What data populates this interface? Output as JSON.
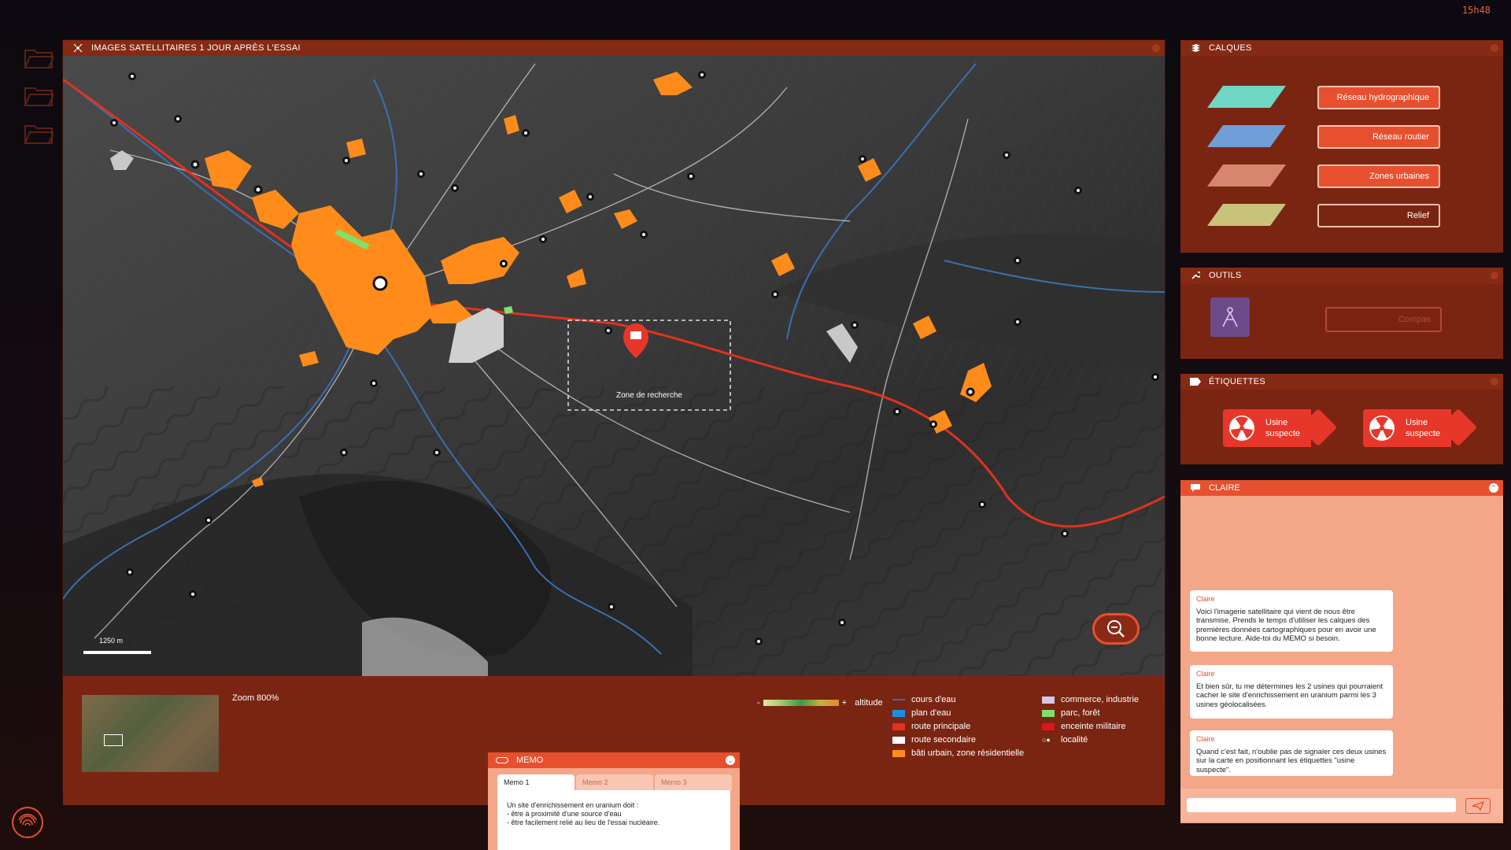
{
  "clock": "15h48",
  "map_window": {
    "title": "IMAGES SATELLITAIRES 1 JOUR APRÈS L'ESSAI",
    "search_zone_label": "Zone de recherche",
    "scale_label": "1250 m",
    "zoom_label": "Zoom 800%"
  },
  "legend": {
    "altitude_minus": "-",
    "altitude_plus": "+",
    "altitude_label": "altitude",
    "items": [
      {
        "label": "cours d'eau",
        "color": "#3a6fb0"
      },
      {
        "label": "plan d'eau",
        "color": "#1a8fe0"
      },
      {
        "label": "route principale",
        "color": "#e0321e"
      },
      {
        "label": "route secondaire",
        "color": "#ffffff"
      },
      {
        "label": "bâti urbain, zone résidentielle",
        "color": "#ff8c1a"
      },
      {
        "label": "commerce, industrie",
        "color": "#d6c7e6"
      },
      {
        "label": "parc, forêt",
        "color": "#7fe06a"
      },
      {
        "label": "enceinte militaire",
        "color": "#e0151a"
      },
      {
        "label": "localité",
        "color": "#ffffff"
      }
    ]
  },
  "calques": {
    "title": "CALQUES",
    "buttons": [
      {
        "label": "Réseau hydrographique",
        "active": true,
        "swatch": "#6fd6c4"
      },
      {
        "label": "Réseau routier",
        "active": true,
        "swatch": "#6f9fd6"
      },
      {
        "label": "Zones urbaines",
        "active": true,
        "swatch": "#d6866c"
      },
      {
        "label": "Relief",
        "active": false,
        "swatch": "#c9c27a"
      }
    ]
  },
  "outils": {
    "title": "OUTILS",
    "tool_label": "Compas"
  },
  "etiquettes": {
    "title": "ÉTIQUETTES",
    "tags": [
      {
        "line1": "Usine",
        "line2": "suspecte"
      },
      {
        "line1": "Usine",
        "line2": "suspecte"
      }
    ]
  },
  "chat": {
    "title": "CLAIRE",
    "messages": [
      {
        "author": "Claire",
        "text": "Voici l'imagerie satellitaire qui vient de nous être transmise. Prends le temps d'utiliser les calques des premières données cartographiques pour en avoir une bonne lecture. Aide-toi du MEMO si besoin."
      },
      {
        "author": "Claire",
        "text": "Et bien sûr, tu me détermines les 2 usines qui pourraient cacher le site d'enrichissement en uranium parmi les 3 usines géolocalisées."
      },
      {
        "author": "Claire",
        "text": "Quand c'est fait, n'oublie pas de signaler ces deux usines sur la carte en positionnant les étiquettes \"usine suspecte\"."
      }
    ],
    "input_value": ""
  },
  "memo": {
    "title": "MEMO",
    "tabs": [
      "Memo 1",
      "Memo 2",
      "Memo 3"
    ],
    "active_tab": "Memo 1",
    "line1": "Un site d'enrichissement en uranium doit :",
    "line2": "- être à proximité d'une source d'eau",
    "line3": "- être facilement relié au lieu de l'essai nucléaire."
  }
}
